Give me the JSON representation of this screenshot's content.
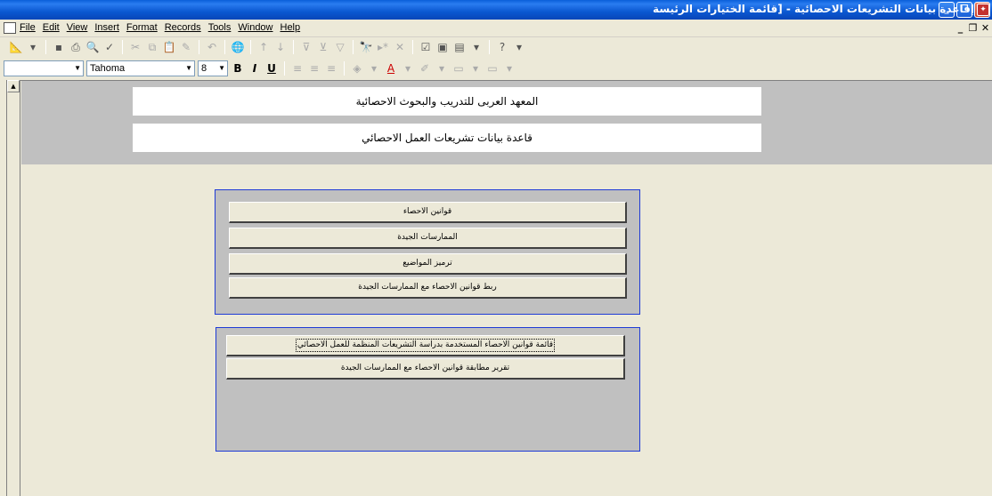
{
  "window": {
    "title": "إقاعدة بيانات التشريعات الاحصائية - [قائمة الختيارات الرئيسة",
    "controls": [
      "_",
      "❐",
      "✕"
    ]
  },
  "menubar": {
    "items": [
      "File",
      "Edit",
      "View",
      "Insert",
      "Format",
      "Records",
      "Tools",
      "Window",
      "Help"
    ],
    "mdi_controls": [
      "_",
      "❐",
      "✕"
    ]
  },
  "toolbar2": {
    "object_combo": "",
    "font_combo": "Tahoma",
    "size_combo": "8"
  },
  "header": {
    "line1": "المعهد العربى للتدريب والبحوث الاحصائية",
    "line2": "قاعدة بيانات تشريعات العمل الاحصائي"
  },
  "panel1": {
    "buttons": [
      "قوانين الاحصاء",
      "الممارسات الجيدة",
      "ترميز المواضيع",
      "ربط قوانين الاحصاء مع الممارسات الجيدة"
    ]
  },
  "panel2": {
    "buttons": [
      "قائمة قوانين الاحصاء المستخدمة بدراسة التشريعات المنظمة للعمل الاحصائي",
      "تقرير مطابقة قوانين الاحصاء مع الممارسات الجيدة"
    ]
  }
}
